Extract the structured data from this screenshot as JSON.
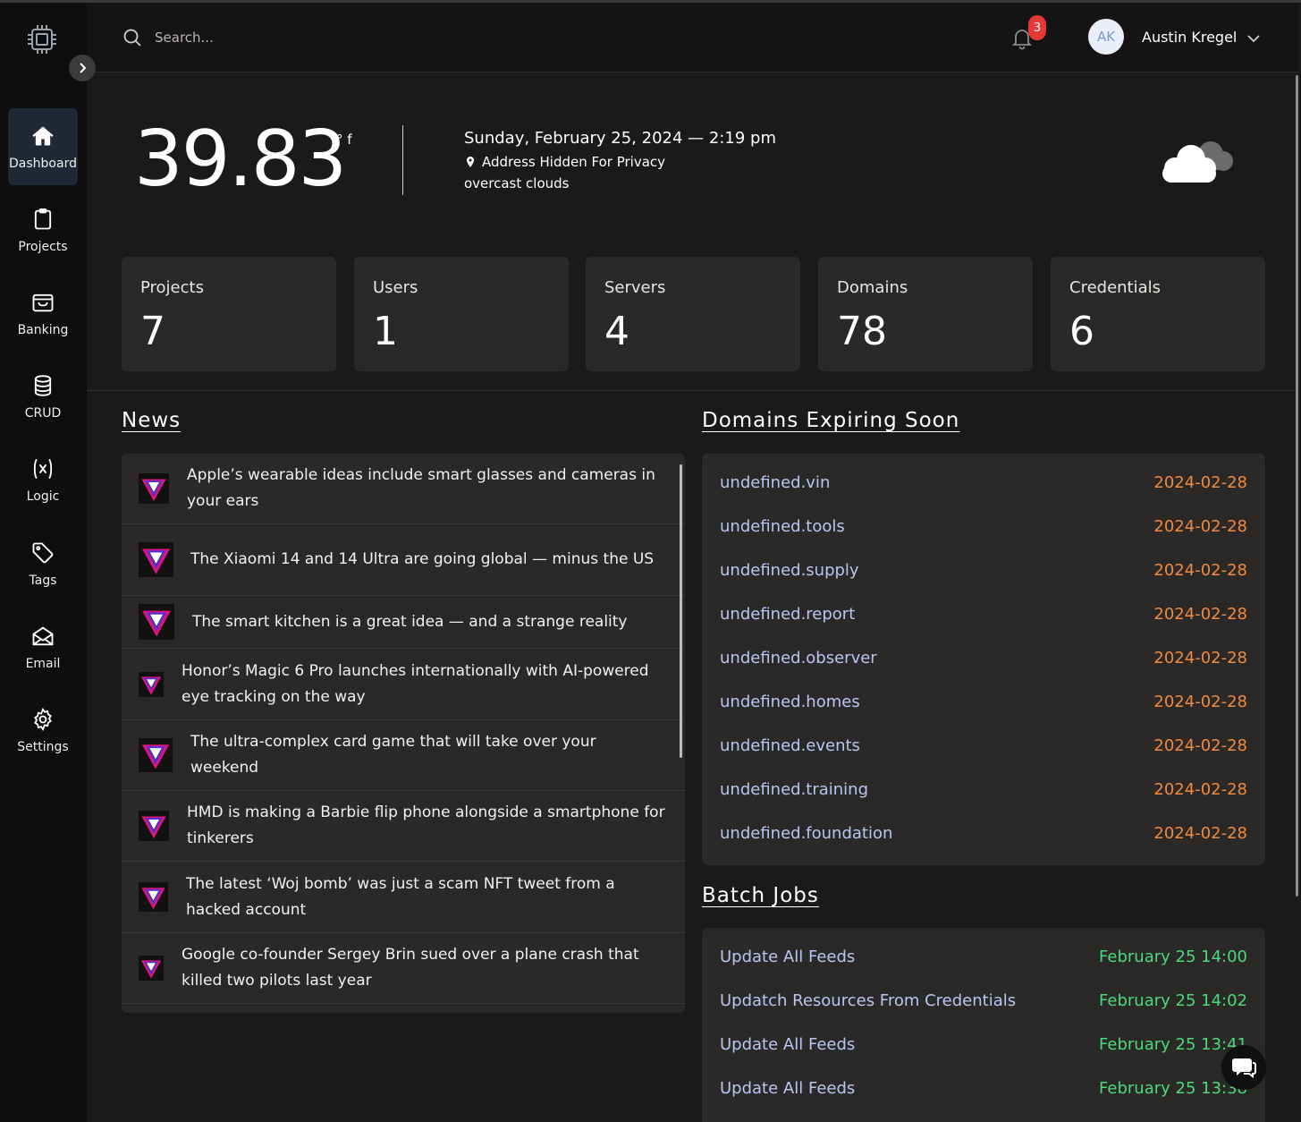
{
  "sidebar": {
    "items": [
      {
        "label": "Dashboard",
        "icon": "home-icon",
        "active": true
      },
      {
        "label": "Projects",
        "icon": "clipboard-icon"
      },
      {
        "label": "Banking",
        "icon": "wallet-icon"
      },
      {
        "label": "CRUD",
        "icon": "database-icon"
      },
      {
        "label": "Logic",
        "icon": "function-icon"
      },
      {
        "label": "Tags",
        "icon": "tag-icon"
      },
      {
        "label": "Email",
        "icon": "envelope-icon"
      },
      {
        "label": "Settings",
        "icon": "gear-icon"
      }
    ]
  },
  "header": {
    "search_placeholder": "Search...",
    "notification_count": "3",
    "user_initials": "AK",
    "user_name": "Austin Kregel"
  },
  "weather": {
    "temperature": "39.83",
    "unit": "° f",
    "date_time": "Sunday, February 25, 2024 — 2:19 pm",
    "location": "Address Hidden For Privacy",
    "description": "overcast clouds"
  },
  "stats": [
    {
      "label": "Projects",
      "value": "7"
    },
    {
      "label": "Users",
      "value": "1"
    },
    {
      "label": "Servers",
      "value": "4"
    },
    {
      "label": "Domains",
      "value": "78"
    },
    {
      "label": "Credentials",
      "value": "6"
    }
  ],
  "news": {
    "title": "News",
    "items": [
      "Apple’s wearable ideas include smart glasses and cameras in your ears",
      "The Xiaomi 14 and 14 Ultra are going global — minus the US",
      "The smart kitchen is a great idea — and a strange reality",
      "Honor’s Magic 6 Pro launches internationally with AI-powered eye tracking on the way",
      "The ultra-complex card game that will take over your weekend",
      "HMD is making a Barbie flip phone alongside a smartphone for tinkerers",
      "The latest ‘Woj bomb’ was just a scam NFT tweet from a hacked account",
      "Google co-founder Sergey Brin sued over a plane crash that killed two pilots last year"
    ]
  },
  "domains": {
    "title": "Domains Expiring Soon",
    "items": [
      {
        "name": "undefined.vin",
        "date": "2024-02-28"
      },
      {
        "name": "undefined.tools",
        "date": "2024-02-28"
      },
      {
        "name": "undefined.supply",
        "date": "2024-02-28"
      },
      {
        "name": "undefined.report",
        "date": "2024-02-28"
      },
      {
        "name": "undefined.observer",
        "date": "2024-02-28"
      },
      {
        "name": "undefined.homes",
        "date": "2024-02-28"
      },
      {
        "name": "undefined.events",
        "date": "2024-02-28"
      },
      {
        "name": "undefined.training",
        "date": "2024-02-28"
      },
      {
        "name": "undefined.foundation",
        "date": "2024-02-28"
      }
    ]
  },
  "batch_jobs": {
    "title": "Batch Jobs",
    "items": [
      {
        "name": "Update All Feeds",
        "time": "February 25 14:00"
      },
      {
        "name": "Updatch Resources From Credentials",
        "time": "February 25 14:02"
      },
      {
        "name": "Update All Feeds",
        "time": "February 25 13:41"
      },
      {
        "name": "Update All Feeds",
        "time": "February 25 13:38"
      }
    ]
  },
  "colors": {
    "domain_name": "#b8c6f2",
    "domain_date": "#f08a3e",
    "job_time": "#4bd97a",
    "badge": "#e53935",
    "active_nav": "#1e2935"
  }
}
